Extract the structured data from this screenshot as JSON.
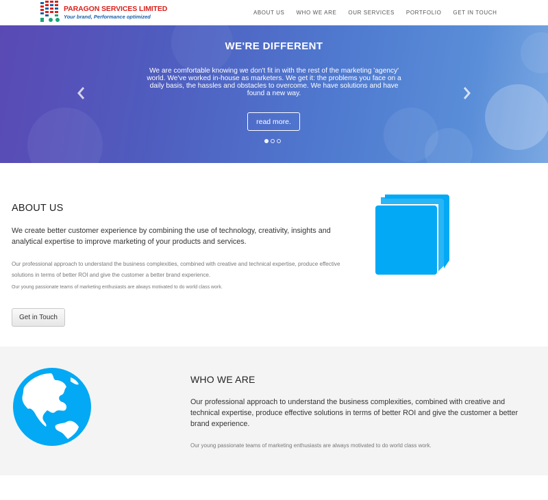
{
  "brand": {
    "name": "PARAGON SERVICES LIMITED",
    "tagline": "Your brand, Performance optimized",
    "colors": {
      "red": "#d9211d",
      "blue": "#1a60a8",
      "teal": "#1aa37a"
    }
  },
  "nav": {
    "items": [
      {
        "label": "ABOUT US"
      },
      {
        "label": "WHO WE ARE"
      },
      {
        "label": "OUR SERVICES"
      },
      {
        "label": "PORTFOLIO"
      },
      {
        "label": "GET IN TOUCH"
      }
    ]
  },
  "hero": {
    "title": "WE'RE DIFFERENT",
    "text": "We are comfortable knowing we don't fit in with the rest of the marketing 'agency' world. We've worked in-house as marketers. We get it: the problems you face on a daily basis, the hassles and obstacles to overcome. We have solutions and have found a new way.",
    "button_label": "read more.",
    "prev_icon": "chevron-left-icon",
    "next_icon": "chevron-right-icon",
    "slide_count": 3,
    "active_slide": 1
  },
  "about": {
    "title": "ABOUT US",
    "lead": "We create better customer experience by combining the use of technology, creativity, insights and analytical expertise to improve marketing of your products and services.",
    "paragraph_1": "Our professional approach to understand the business complexities, combined with creative and technical expertise, produce effective solutions in terms of better ROI and give the customer a better brand experience.",
    "paragraph_2": "Our young passionate teams of marketing enthusiasts are always motivated to do world class work.",
    "button_label": "Get in Touch",
    "icon": "book-icon",
    "icon_color": "#03a9f4"
  },
  "who": {
    "title": "WHO WE ARE",
    "lead": "Our professional approach to understand the business complexities, combined with creative and technical expertise, produce effective solutions in terms of better ROI and give the customer a better brand experience.",
    "paragraph": "Our young passionate teams of marketing enthusiasts are always motivated to do world class work.",
    "icon": "globe-icon",
    "icon_color": "#03a9f4"
  }
}
